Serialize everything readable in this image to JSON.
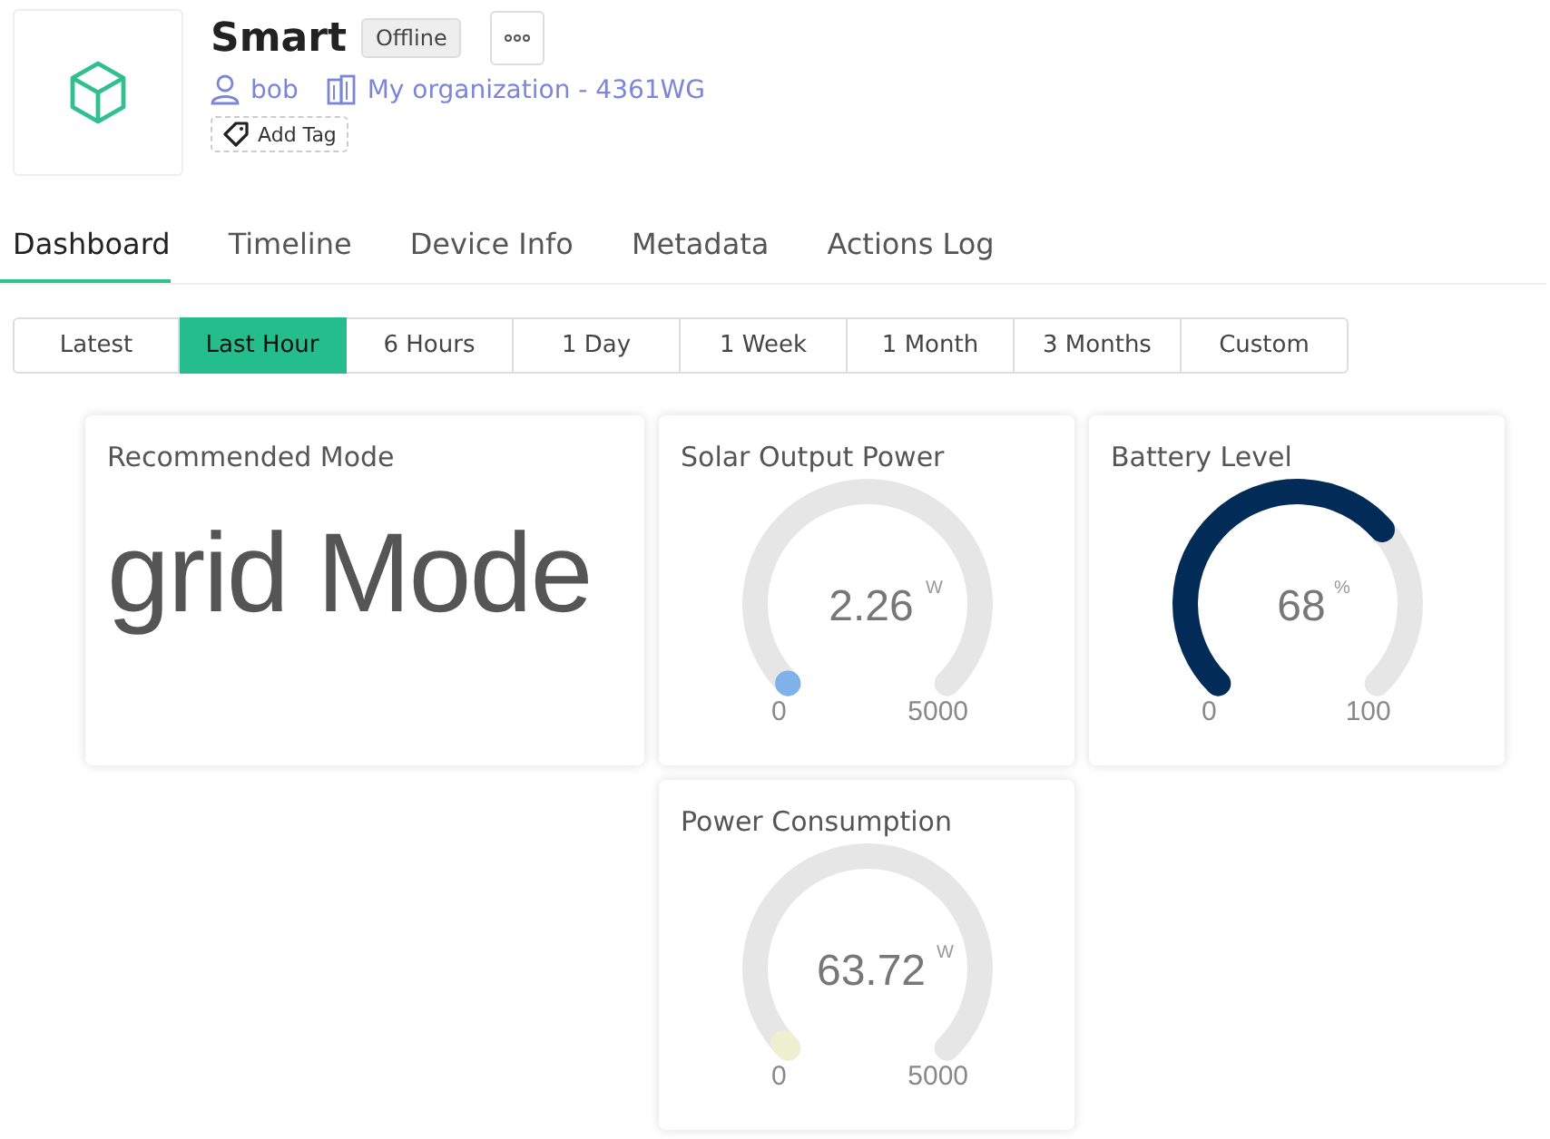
{
  "device": {
    "name": "Smart",
    "status": "Offline",
    "owner": "bob",
    "organization": "My organization - 4361WG",
    "add_tag": "Add Tag"
  },
  "tabs": [
    {
      "label": "Dashboard",
      "selected": true
    },
    {
      "label": "Timeline",
      "selected": false
    },
    {
      "label": "Device Info",
      "selected": false
    },
    {
      "label": "Metadata",
      "selected": false
    },
    {
      "label": "Actions Log",
      "selected": false
    }
  ],
  "time_ranges": [
    {
      "label": "Latest",
      "selected": false
    },
    {
      "label": "Last Hour",
      "selected": true
    },
    {
      "label": "6 Hours",
      "selected": false
    },
    {
      "label": "1 Day",
      "selected": false
    },
    {
      "label": "1 Week",
      "selected": false
    },
    {
      "label": "1 Month",
      "selected": false
    },
    {
      "label": "3 Months",
      "selected": false
    },
    {
      "label": "Custom",
      "selected": false
    }
  ],
  "widgets": [
    {
      "kind": "text",
      "title": "Recommended Mode",
      "value": "grid Mode"
    },
    {
      "kind": "gauge",
      "title": "Solar Output Power",
      "value": "2.26",
      "unit": "W",
      "min": "0",
      "max": "5000",
      "color": "#7fb2ea"
    },
    {
      "kind": "gauge",
      "title": "Battery Level",
      "value": "68",
      "unit": "%",
      "min": "0",
      "max": "100",
      "color": "#032b57"
    },
    {
      "kind": "gauge",
      "title": "Power Consumption",
      "value": "63.72",
      "unit": "W",
      "min": "0",
      "max": "5000",
      "color": "#eef0d2"
    }
  ]
}
